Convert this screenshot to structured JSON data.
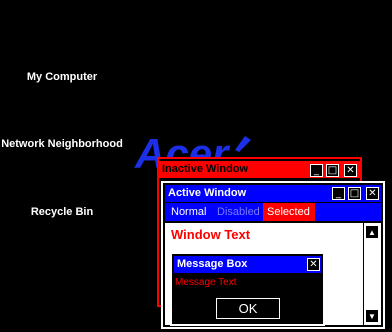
{
  "desktop": {
    "icons": [
      {
        "label": "My Computer"
      },
      {
        "label": "Network Neighborhood"
      },
      {
        "label": "Recycle Bin"
      }
    ],
    "logo_text": "Acer"
  },
  "inactive_window": {
    "title": "Inactive Window",
    "buttons": {
      "minimize": "_",
      "maximize": "□",
      "close": "✕"
    }
  },
  "active_window": {
    "title": "Active Window",
    "buttons": {
      "minimize": "_",
      "maximize": "□",
      "close": "✕"
    },
    "menu": {
      "normal": "Normal",
      "disabled": "Disabled",
      "selected": "Selected"
    },
    "window_text": "Window Text",
    "scroll": {
      "up": "▲",
      "down": "▼"
    }
  },
  "message_box": {
    "title": "Message Box",
    "close": "✕",
    "text": "Message Text",
    "ok_label": "OK"
  },
  "colors": {
    "desktop": "#000000",
    "active_title": "#0000ff",
    "inactive_title": "#ff0000",
    "highlight": "#ff0000",
    "window_text": "#ff0000",
    "disabled_text": "#7a7aff"
  }
}
